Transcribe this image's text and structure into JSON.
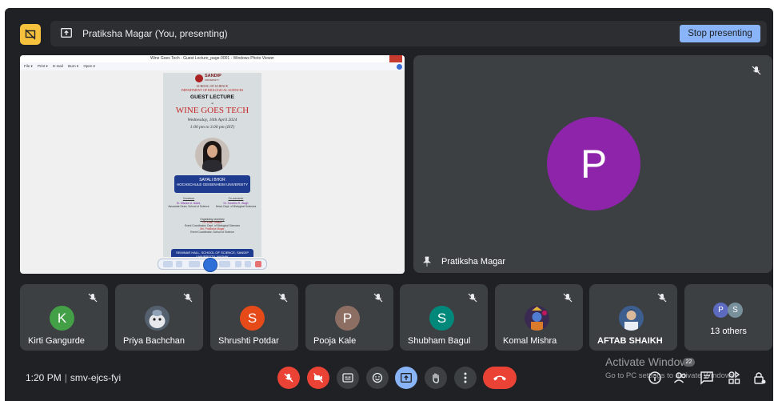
{
  "presenting": {
    "text": "Pratiksha Magar (You, presenting)",
    "stop_label": "Stop presenting"
  },
  "shared_screen": {
    "window_title": "Wine Goes Tech - Guest Lecture_page-0001 - Windows Photo Viewer",
    "menu": [
      "File ▾",
      "Print ▾",
      "E-mail",
      "Burn ▾",
      "Open ▾"
    ],
    "poster": {
      "org": "SANDIP",
      "org_sub": "UNIVERSITY",
      "school": "SCHOOL OF SCIENCE",
      "dept": "DEPARTMENT OF BIOLOGICAL SCIENCES",
      "heading": "GUEST LECTURE",
      "on": "on",
      "title": "WINE GOES TECH",
      "date": "Wednesday, 10th April 2024",
      "time": "1:00 pm to 3.00 pm (IST)",
      "speaker": "SAYALI BHOR",
      "speaker_org": "HOCHSCHULE GEISENHEIM UNIVERSITY",
      "convener_label": "Convener",
      "convener_name": "Dr. Mission A. Bashi,",
      "convener_role": "Associate Dean, School of Science",
      "coconvener_label": "Co-convener",
      "coconvener_name": "Dr. Sunetha R. Wagh",
      "coconvener_role": "Head, Dept. of Biological Sciences",
      "organizing_label": "Organizing secretary",
      "sec1_name": "Dr. Kiran Thakur",
      "sec1_role": "Event Coordinator, Dept. of Biological Sciences",
      "sec2_name": "Ms. Pratiksha Magar",
      "sec2_role": "Event Coordinator, School of Science",
      "venue": "SEMINAR HALL, SCHOOL OF SCIENCE, SANDIP UNIVERSITY, NASHIK"
    }
  },
  "main_tile": {
    "avatar_letter": "P",
    "avatar_color": "#8e24aa",
    "name": "Pratiksha Magar"
  },
  "participants": [
    {
      "name": "Kirti Gangurde",
      "letter": "K",
      "color": "#43a047"
    },
    {
      "name": "Priya Bachchan",
      "photo": "cartoon"
    },
    {
      "name": "Shrushti Potdar",
      "letter": "S",
      "color": "#e64a19"
    },
    {
      "name": "Pooja Kale",
      "letter": "P",
      "color": "#8d6e63"
    },
    {
      "name": "Shubham Bagul",
      "letter": "S",
      "color": "#00897b"
    },
    {
      "name": "Komal Mishra",
      "photo": "deity"
    },
    {
      "name": "AFTAB SHAIKH",
      "photo": "character"
    }
  ],
  "others": {
    "label": "13 others",
    "avatars": [
      {
        "letter": "P",
        "color": "#5c6bc0"
      },
      {
        "letter": "S",
        "color": "#78909c"
      }
    ]
  },
  "bottom_bar": {
    "time": "1:20 PM",
    "meeting_code": "smv-ejcs-fyi",
    "people_count": "22"
  },
  "watermark": {
    "title": "Activate Windows",
    "subtitle": "Go to PC settings to activate Windows."
  },
  "icons": {
    "present": "present-to-all-icon",
    "mic_off": "mic-off-icon",
    "cam_off": "videocam-off-icon",
    "captions": "captions-icon",
    "emoji": "emoji-icon",
    "raise_hand": "hand-icon",
    "more": "more-vert-icon",
    "end_call": "call-end-icon",
    "info": "info-icon",
    "people": "people-icon",
    "chat": "chat-icon",
    "activities": "activities-icon",
    "host_controls": "lock-person-icon"
  }
}
